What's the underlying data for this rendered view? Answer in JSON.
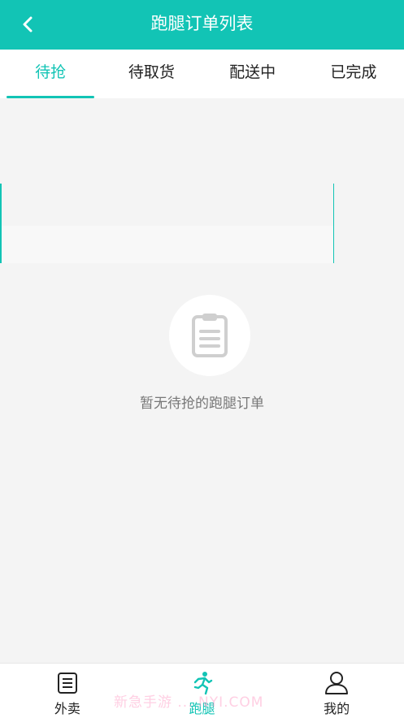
{
  "header": {
    "title": "跑腿订单列表",
    "back_icon": "chevron-left-icon"
  },
  "tabs": [
    {
      "label": "待抢",
      "active": true
    },
    {
      "label": "待取货",
      "active": false
    },
    {
      "label": "配送中",
      "active": false
    },
    {
      "label": "已完成",
      "active": false
    }
  ],
  "empty_state": {
    "icon": "clipboard-icon",
    "message": "暂无待抢的跑腿订单"
  },
  "tabbar": {
    "items": [
      {
        "label": "外卖",
        "icon": "list-document-icon",
        "active": false
      },
      {
        "label": "跑腿",
        "icon": "runner-icon",
        "active": true
      },
      {
        "label": "我的",
        "icon": "user-icon",
        "active": false
      }
    ]
  },
  "watermark": "新急手游 ... NYI.COM",
  "colors": {
    "accent": "#12c4b5",
    "background": "#f4f4f4"
  }
}
